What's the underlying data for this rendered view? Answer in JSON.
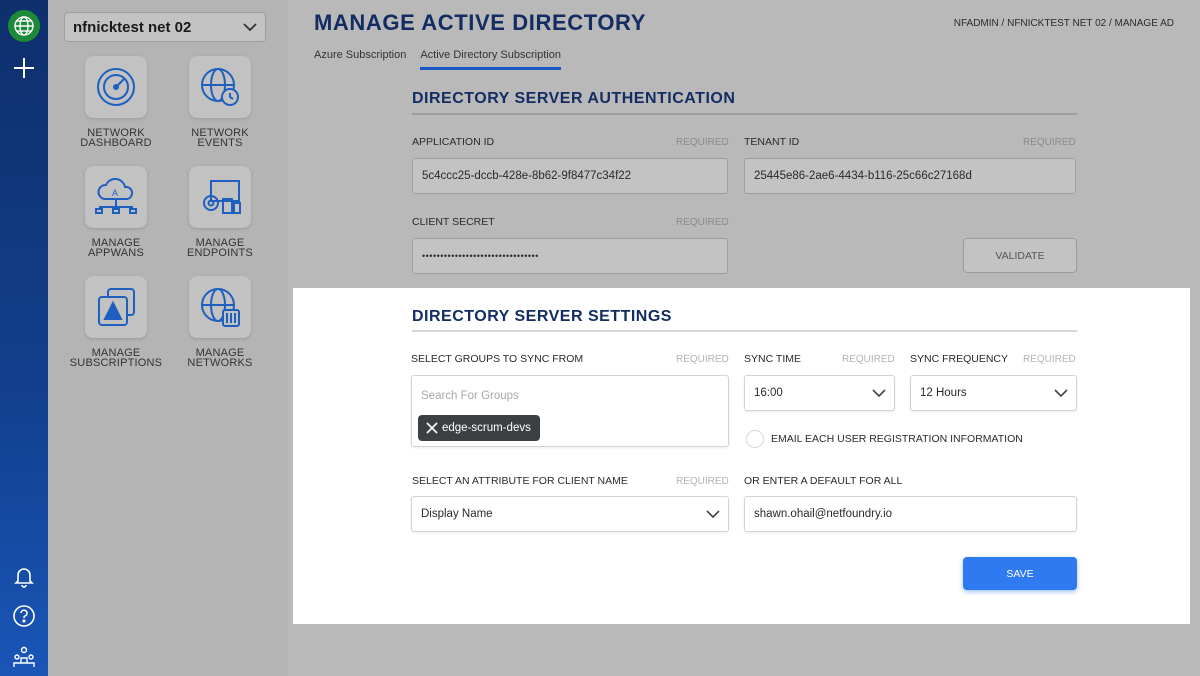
{
  "network_selector": {
    "value": "nfnicktest net 02"
  },
  "tiles": [
    {
      "label": "NETWORK\nDASHBOARD"
    },
    {
      "label": "NETWORK\nEVENTS"
    },
    {
      "label": "MANAGE\nAPPWANS"
    },
    {
      "label": "MANAGE\nENDPOINTS"
    },
    {
      "label": "MANAGE\nSUBSCRIPTIONS"
    },
    {
      "label": "MANAGE\nNETWORKS"
    }
  ],
  "page": {
    "title": "MANAGE ACTIVE DIRECTORY",
    "breadcrumb": "NFADMIN / NFNICKTEST NET 02 / MANAGE AD",
    "tabs": [
      "Azure Subscription",
      "Active Directory Subscription"
    ]
  },
  "auth": {
    "title": "DIRECTORY SERVER AUTHENTICATION",
    "app_id_label": "APPLICATION ID",
    "app_id_value": "5c4ccc25-dccb-428e-8b62-9f8477c34f22",
    "tenant_label": "TENANT ID",
    "tenant_value": "25445e86-2ae6-4434-b116-25c66c27168d",
    "secret_label": "CLIENT SECRET",
    "secret_value": "••••••••••••••••••••••••••••••••",
    "required": "REQUIRED",
    "validate": "VALIDATE"
  },
  "settings": {
    "title": "DIRECTORY SERVER SETTINGS",
    "groups_label": "SELECT GROUPS TO SYNC FROM",
    "groups_placeholder": "Search For Groups",
    "groups_chip": "edge-scrum-devs",
    "sync_time_label": "SYNC TIME",
    "sync_time_value": "16:00",
    "sync_freq_label": "SYNC FREQUENCY",
    "sync_freq_value": "12 Hours",
    "email_label": "EMAIL EACH USER REGISTRATION INFORMATION",
    "attr_label": "SELECT AN ATTRIBUTE FOR CLIENT NAME",
    "attr_value": "Display Name",
    "default_label": "OR ENTER A DEFAULT FOR ALL",
    "default_value": "shawn.ohail@netfoundry.io",
    "required": "REQUIRED",
    "save": "SAVE"
  },
  "colors": {
    "accent": "#2f7af0",
    "nav": "#12408f",
    "title": "#132d63"
  }
}
